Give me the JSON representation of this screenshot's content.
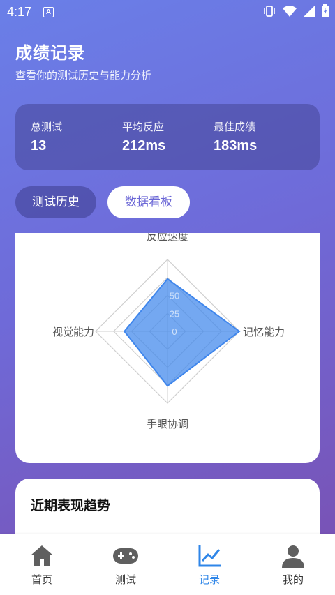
{
  "status_bar": {
    "time": "4:17",
    "notification_letter": "A"
  },
  "header": {
    "title": "成绩记录",
    "subtitle": "查看你的测试历史与能力分析"
  },
  "stats": [
    {
      "label": "总测试",
      "value": "13"
    },
    {
      "label": "平均反应",
      "value": "212ms"
    },
    {
      "label": "最佳成绩",
      "value": "183ms"
    }
  ],
  "tabs": {
    "history": "测试历史",
    "dashboard": "数据看板"
  },
  "chart_data": {
    "type": "radar",
    "axes": [
      "反应速度",
      "记忆能力",
      "手眼协调",
      "视觉能力"
    ],
    "values": [
      73,
      100,
      76,
      60
    ],
    "max": 100,
    "tick_labels": [
      "0",
      "25",
      "50"
    ],
    "series_color": "#3f86ec"
  },
  "trend": {
    "title": "近期表现趋势"
  },
  "nav": [
    {
      "label": "首页",
      "icon": "home-icon"
    },
    {
      "label": "测试",
      "icon": "gamepad-icon"
    },
    {
      "label": "记录",
      "icon": "chart-line-icon",
      "active": true
    },
    {
      "label": "我的",
      "icon": "user-icon"
    }
  ],
  "colors": {
    "accent": "#2f86e8",
    "tab_active_text": "#6b67d6"
  }
}
